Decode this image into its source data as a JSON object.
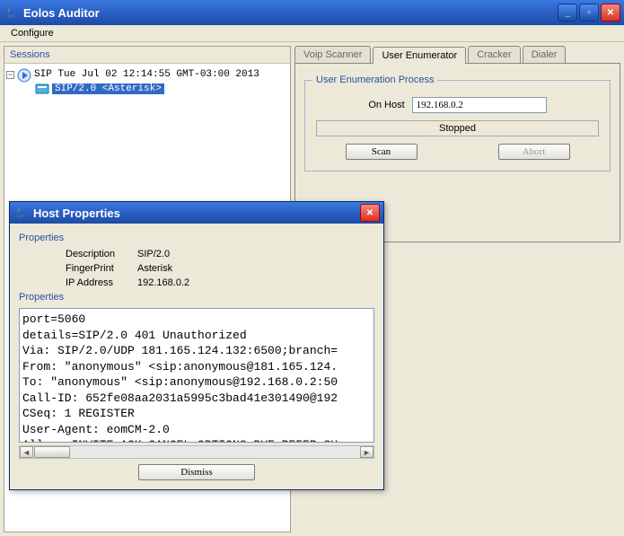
{
  "main_window": {
    "title": "Eolos Auditor",
    "menu": {
      "configure": "Configure"
    }
  },
  "tree": {
    "panel_title": "Sessions",
    "session_label": "SIP Tue Jul 02 12:14:55 GMT-03:00 2013",
    "host_label": "SIP/2.0 <Asterisk>"
  },
  "tabs": {
    "voip_scanner": "Voip Scanner",
    "user_enumerator": "User Enumerator",
    "cracker": "Cracker",
    "dialer": "Dialer"
  },
  "enum_panel": {
    "group_title": "User Enumeration Process",
    "on_host_label": "On Host",
    "on_host_value": "192.168.0.2",
    "status": "Stopped",
    "scan_btn": "Scan",
    "abort_btn": "Abort"
  },
  "dialog": {
    "title": "Host Properties",
    "section1": "Properties",
    "desc_k": "Description",
    "desc_v": "SIP/2.0",
    "fp_k": "FingerPrint",
    "fp_v": "Asterisk",
    "ip_k": "IP Address",
    "ip_v": "192.168.0.2",
    "section2": "Properties",
    "raw": "port=5060\ndetails=SIP/2.0 401 Unauthorized\nVia: SIP/2.0/UDP 181.165.124.132:6500;branch=\nFrom: \"anonymous\" <sip:anonymous@181.165.124.\nTo: \"anonymous\" <sip:anonymous@192.168.0.2:50\nCall-ID: 652fe08aa2031a5995c3bad41e301490@192\nCSeq: 1 REGISTER\nUser-Agent: eomCM-2.0\nAllow: INVITE,ACK,CANCEL,OPTIONS,BYE,REFER,SU",
    "dismiss": "Dismiss"
  }
}
